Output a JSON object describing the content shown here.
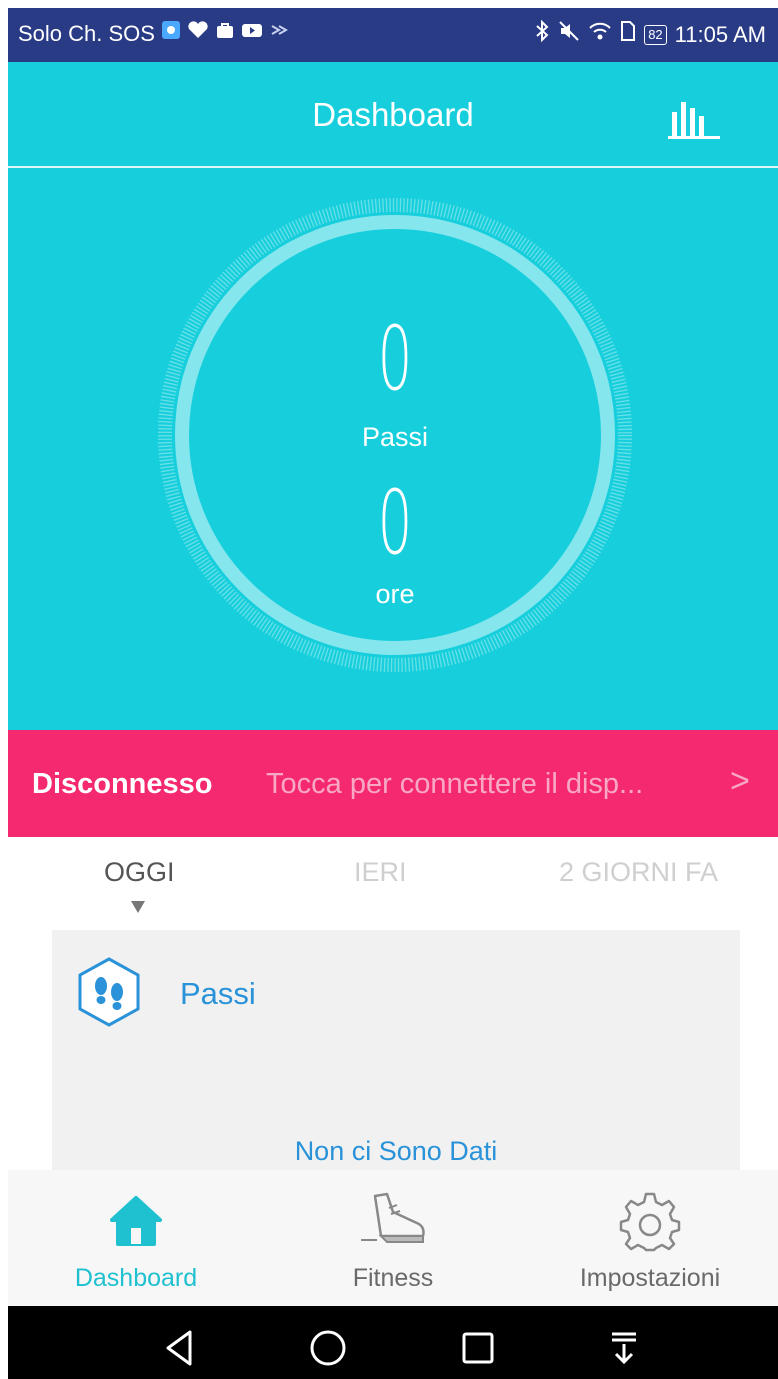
{
  "status_bar": {
    "carrier": "Solo Ch. SOS",
    "battery": "82",
    "time": "11:05 AM",
    "icons_left": [
      "app-badge-icon",
      "heart-icon",
      "bag-icon",
      "video-icon",
      "cast-icon"
    ],
    "icons_right": [
      "bluetooth-icon",
      "mute-icon",
      "wifi-icon",
      "sim-icon",
      "battery-icon"
    ]
  },
  "header": {
    "title": "Dashboard",
    "right_icon": "bar-chart-icon"
  },
  "summary": {
    "steps_value": "0",
    "steps_label": "Passi",
    "hours_value": "0",
    "hours_label": "ore"
  },
  "connection_banner": {
    "status": "Disconnesso",
    "hint": "Tocca per connettere il disp...",
    "chevron": ">"
  },
  "day_tabs": {
    "selected": "OGGI",
    "items": [
      {
        "label": "OGGI"
      },
      {
        "label": "IERI"
      },
      {
        "label": "2 GIORNI FA"
      }
    ]
  },
  "steps_card": {
    "icon": "footsteps-icon",
    "title": "Passi",
    "empty_text": "Non ci Sono Dati"
  },
  "bottom_nav": {
    "selected": "Dashboard",
    "items": [
      {
        "label": "Dashboard",
        "icon": "home-icon"
      },
      {
        "label": "Fitness",
        "icon": "shoe-icon"
      },
      {
        "label": "Impostazioni",
        "icon": "gear-icon"
      }
    ]
  },
  "system_nav": {
    "buttons": [
      "back-icon",
      "home-circle-icon",
      "recents-icon",
      "notification-pull-icon"
    ]
  },
  "colors": {
    "status_bar": "#2a3b86",
    "primary": "#17cfdc",
    "banner": "#f5296f",
    "accent_text": "#2a92d8",
    "nav_active": "#1fc0d0"
  }
}
